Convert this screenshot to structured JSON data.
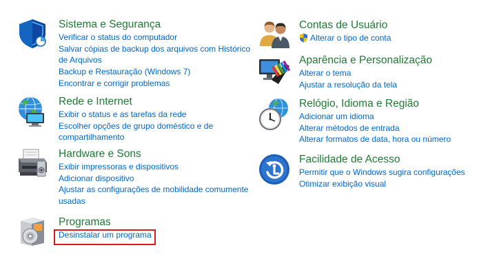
{
  "categories": {
    "sistema": {
      "title": "Sistema e Segurança",
      "icon": "shield-icon",
      "links": [
        "Verificar o status do computador",
        "Salvar cópias de backup dos arquivos com Histórico de Arquivos",
        "Backup e Restauração (Windows 7)",
        "Encontrar e corrigir problemas"
      ]
    },
    "rede": {
      "title": "Rede e Internet",
      "icon": "network-globe-icon",
      "links": [
        "Exibir o status e as tarefas da rede",
        "Escolher opções de grupo doméstico e de compartilhamento"
      ]
    },
    "hardware": {
      "title": "Hardware e Sons",
      "icon": "printer-icon",
      "links": [
        "Exibir impressoras e dispositivos",
        "Adicionar dispositivo",
        "Ajustar as configurações de mobilidade comumente usadas"
      ]
    },
    "programas": {
      "title": "Programas",
      "icon": "programs-disc-icon",
      "links": [
        "Desinstalar um programa"
      ]
    },
    "contas": {
      "title": "Contas de Usuário",
      "icon": "users-icon",
      "links": [
        "Alterar o tipo de conta"
      ]
    },
    "aparencia": {
      "title": "Aparência e Personalização",
      "icon": "display-palette-icon",
      "links": [
        "Alterar o tema",
        "Ajustar a resolução da tela"
      ]
    },
    "relogio": {
      "title": "Relógio, Idioma e Região",
      "icon": "clock-globe-icon",
      "links": [
        "Adicionar um idioma",
        "Alterar métodos de entrada",
        "Alterar formatos de data, hora ou número"
      ]
    },
    "facilidade": {
      "title": "Facilidade de Acesso",
      "icon": "ease-of-access-icon",
      "links": [
        "Permitir que o Windows sugira configurações",
        "Otimizar exibição visual"
      ]
    }
  },
  "colors": {
    "title_green": "#1e7b34",
    "link_blue": "#0066cc",
    "highlight_red": "#e0181e"
  }
}
